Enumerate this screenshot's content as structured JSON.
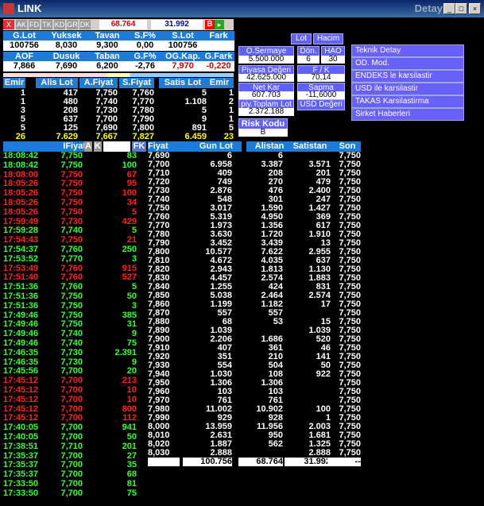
{
  "window": {
    "title": "LINK",
    "right_title": "Detay"
  },
  "toolbar": {
    "buttons": [
      "X",
      "AK",
      "FD",
      "TK",
      "KD",
      "GR",
      "DK"
    ],
    "price": "68.764",
    "price2": "31.992",
    "b_label": "B"
  },
  "summary": {
    "headers": [
      "G.Lot",
      "Yuksek",
      "Tavan",
      "S.F%",
      "S.Lot",
      "Fark"
    ],
    "values": [
      "100756",
      "8,030",
      "9,300",
      "0,00",
      "100756",
      ""
    ],
    "headers2": [
      "AOF",
      "Dusuk",
      "Taban",
      "G.F%",
      "OG.Kap.",
      "G.Fark"
    ],
    "values2": [
      "7,866",
      "7,690",
      "6,200",
      "-2,76",
      "7,970",
      "-0,220"
    ]
  },
  "depth": {
    "headers": [
      "Emir",
      "Alis Lot",
      "A.Fiyat",
      "S.Fiyat",
      "Satis Lot",
      "Emir"
    ],
    "rows": [
      [
        "1",
        "417",
        "7,750",
        "7,760",
        "5",
        "1"
      ],
      [
        "1",
        "480",
        "7,740",
        "7,770",
        "1.108",
        "2"
      ],
      [
        "3",
        "208",
        "7,730",
        "7,780",
        "5",
        "1"
      ],
      [
        "5",
        "637",
        "7,700",
        "7,790",
        "9",
        "1"
      ],
      [
        "5",
        "125",
        "7,690",
        "7,800",
        "891",
        "5"
      ]
    ],
    "total": [
      "26",
      "7.629",
      "7,667",
      "7,827",
      "6.459",
      "23"
    ]
  },
  "popup": {
    "lot": "Lot",
    "hacim": "Hacim",
    "o_sermaye": "O.Sermaye",
    "o_sermaye_v": "5.500.000",
    "don": "Dön.",
    "don_v": "6",
    "hao": "HAO",
    "hao_v": "30",
    "piyasa": "Piyasa Değeri",
    "piyasa_v": "42.625.000",
    "fk": "F / K",
    "fk_v": "70,14",
    "netkar": "Net Kar",
    "netkar_v": "607.703",
    "sapma": "Sapma",
    "sapma_v": "-11,6000",
    "topl": "piy.Toplam Lot",
    "topl_v": "2.372.188",
    "usd": "USD Değeri",
    "risk": "Risk Kodu",
    "risk_v": "B"
  },
  "menu": [
    "Teknik Detay",
    "OD. Mod.",
    "ENDEKS le karsilastir",
    "USD ile karsilastir",
    "TAKAS Karsilastirma",
    "Sirket Haberleri"
  ],
  "trades": {
    "headers": [
      "IFiyat",
      "A",
      "K",
      "FK"
    ],
    "rows": [
      [
        "18:08:42",
        "7,750",
        "83",
        "g"
      ],
      [
        "18:08:42",
        "7,750",
        "100",
        "g"
      ],
      [
        "18:08:00",
        "7,750",
        "67",
        "r"
      ],
      [
        "18:05:26",
        "7,750",
        "95",
        "r"
      ],
      [
        "18:05:26",
        "7,750",
        "100",
        "r"
      ],
      [
        "18:05:26",
        "7,750",
        "34",
        "r"
      ],
      [
        "18:05:26",
        "7,750",
        "5",
        "r"
      ],
      [
        "17:59:49",
        "7,730",
        "429",
        "r"
      ],
      [
        "17:59:28",
        "7,740",
        "5",
        "g"
      ],
      [
        "17:54:43",
        "7,750",
        "21",
        "r"
      ],
      [
        "17:54:37",
        "7,760",
        "250",
        "g"
      ],
      [
        "17:53:52",
        "7,770",
        "3",
        "g"
      ],
      [
        "17:53:49",
        "7,760",
        "915",
        "r"
      ],
      [
        "17:51:40",
        "7,760",
        "527",
        "r"
      ],
      [
        "17:51:36",
        "7,760",
        "5",
        "g"
      ],
      [
        "17:51:36",
        "7,750",
        "50",
        "g"
      ],
      [
        "17:51:36",
        "7,750",
        "3",
        "g"
      ],
      [
        "17:49:46",
        "7,750",
        "385",
        "g"
      ],
      [
        "17:49:46",
        "7,750",
        "31",
        "g"
      ],
      [
        "17:49:46",
        "7,740",
        "9",
        "g"
      ],
      [
        "17:49:46",
        "7,740",
        "75",
        "g"
      ],
      [
        "17:46:35",
        "7,730",
        "2.391",
        "g"
      ],
      [
        "17:46:35",
        "7,730",
        "9",
        "g"
      ],
      [
        "17:45:56",
        "7,700",
        "20",
        "g"
      ],
      [
        "17:45:12",
        "7,700",
        "213",
        "r"
      ],
      [
        "17:45:12",
        "7,700",
        "10",
        "r"
      ],
      [
        "17:45:12",
        "7,700",
        "10",
        "r"
      ],
      [
        "17:45:12",
        "7,700",
        "800",
        "r"
      ],
      [
        "17:45:12",
        "7,700",
        "112",
        "r"
      ],
      [
        "17:40:05",
        "7,700",
        "941",
        "g"
      ],
      [
        "17:40:05",
        "7,700",
        "50",
        "g"
      ],
      [
        "17:38:51",
        "7,710",
        "201",
        "g"
      ],
      [
        "17:35:37",
        "7,700",
        "27",
        "g"
      ],
      [
        "17:35:37",
        "7,700",
        "35",
        "g"
      ],
      [
        "17:35:37",
        "7,700",
        "68",
        "g"
      ],
      [
        "17:33:50",
        "7,700",
        "81",
        "g"
      ],
      [
        "17:33:50",
        "7,700",
        "75",
        "g"
      ]
    ]
  },
  "volume": {
    "headers": [
      "Fiyat",
      "Gun Lot",
      "Alistan",
      "Satistan",
      "Son"
    ],
    "rows": [
      [
        "7,690",
        "6",
        "6",
        "",
        "7,750"
      ],
      [
        "7,700",
        "6.958",
        "3.387",
        "3.571",
        "7,750"
      ],
      [
        "7,710",
        "409",
        "208",
        "201",
        "7,750"
      ],
      [
        "7,720",
        "749",
        "270",
        "479",
        "7,750"
      ],
      [
        "7,730",
        "2.876",
        "476",
        "2.400",
        "7,750"
      ],
      [
        "7,740",
        "548",
        "301",
        "247",
        "7,750"
      ],
      [
        "7,750",
        "3.017",
        "1.590",
        "1.427",
        "7,750"
      ],
      [
        "7,760",
        "5.319",
        "4.950",
        "369",
        "7,750"
      ],
      [
        "7,770",
        "1.973",
        "1.356",
        "617",
        "7,750"
      ],
      [
        "7,780",
        "3.630",
        "1.720",
        "1.910",
        "7,750"
      ],
      [
        "7,790",
        "3.452",
        "3.439",
        "13",
        "7,750"
      ],
      [
        "7,800",
        "10.577",
        "7.622",
        "2.955",
        "7,750"
      ],
      [
        "7,810",
        "4.672",
        "4.035",
        "637",
        "7,750"
      ],
      [
        "7,820",
        "2.943",
        "1.813",
        "1.130",
        "7,750"
      ],
      [
        "7,830",
        "4.457",
        "2.574",
        "1.883",
        "7,750"
      ],
      [
        "7,840",
        "1.255",
        "424",
        "831",
        "7,750"
      ],
      [
        "7,850",
        "5.038",
        "2.464",
        "2.574",
        "7,750"
      ],
      [
        "7,860",
        "1.199",
        "1.182",
        "17",
        "7,750"
      ],
      [
        "7,870",
        "557",
        "557",
        "",
        "7,750"
      ],
      [
        "7,880",
        "68",
        "53",
        "15",
        "7,750"
      ],
      [
        "7,890",
        "1.039",
        "",
        "1.039",
        "7,750"
      ],
      [
        "7,900",
        "2.206",
        "1.686",
        "520",
        "7,750"
      ],
      [
        "7,910",
        "407",
        "361",
        "46",
        "7,750"
      ],
      [
        "7,920",
        "351",
        "210",
        "141",
        "7,750"
      ],
      [
        "7,930",
        "554",
        "504",
        "50",
        "7,750"
      ],
      [
        "7,940",
        "1.030",
        "108",
        "922",
        "7,750"
      ],
      [
        "7,950",
        "1.306",
        "1.306",
        "",
        "7,750"
      ],
      [
        "7,960",
        "103",
        "103",
        "",
        "7,750"
      ],
      [
        "7,970",
        "761",
        "761",
        "",
        "7,750"
      ],
      [
        "7,980",
        "11.002",
        "10.902",
        "100",
        "7,750"
      ],
      [
        "7,990",
        "929",
        "928",
        "1",
        "7,750"
      ],
      [
        "8,000",
        "13.959",
        "11.956",
        "2.003",
        "7,750"
      ],
      [
        "8,010",
        "2.631",
        "950",
        "1.681",
        "7,750"
      ],
      [
        "8,020",
        "1.887",
        "562",
        "1.325",
        "7,750"
      ],
      [
        "8,030",
        "2.888",
        "",
        "2.888",
        "7,750"
      ]
    ],
    "total": [
      "",
      "100.756",
      "68.764",
      "31.992",
      "--"
    ]
  }
}
